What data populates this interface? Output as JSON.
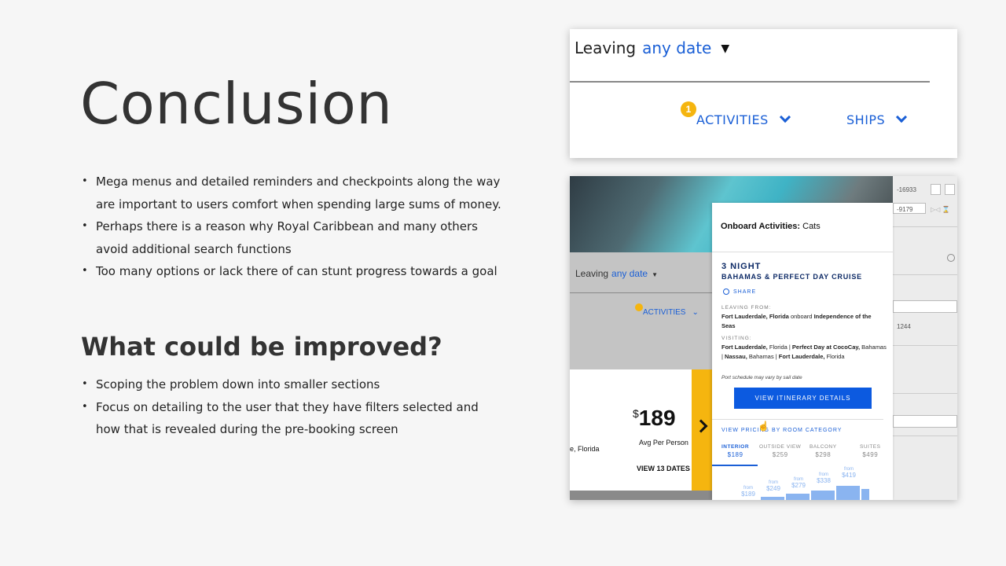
{
  "left": {
    "title": "Conclusion",
    "bullets1": [
      "Mega menus and detailed reminders and checkpoints along the way are important to users comfort  when spending large sums of money.",
      "Perhaps there is a reason why Royal Caribbean and many others avoid additional search functions",
      "Too many options or lack there of can stunt progress towards a goal"
    ],
    "subtitle": "What could be improved?",
    "bullets2": [
      "Scoping the problem down into smaller sections",
      "Focus on detailing to the user that they have filters selected and how that is revealed during the pre-booking screen"
    ]
  },
  "card1": {
    "leaving_label": "Leaving",
    "leaving_value": "any date",
    "badge": "1",
    "activities": "ACTIVITIES",
    "ships": "SHIPS"
  },
  "card2": {
    "leaving_label": "Leaving",
    "leaving_value": "any date",
    "activities": "ACTIVITIES",
    "price_symbol": "$",
    "price": "189",
    "avg": "Avg Per Person",
    "view_dates": "VIEW 13 DATES",
    "location_partial": "e, Florida",
    "side_values": [
      "-16933",
      "-9179",
      "1244"
    ],
    "popup": {
      "title_bold": "Onboard Activities:",
      "title_value": "Cats",
      "nights": "3 NIGHT",
      "cruise": "BAHAMAS & PERFECT DAY CRUISE",
      "share": "SHARE",
      "leaving_label": "LEAVING FROM:",
      "leaving_city": "Fort Lauderdale, Florida",
      "onboard_word": "onboard",
      "ship": "Independence of the Seas",
      "visiting_label": "VISITING:",
      "visit1_bold": "Fort Lauderdale,",
      "visit1_rest": "Florida",
      "visit2": "Perfect Day at CocoCay,",
      "visit3_rest": "Bahamas",
      "visit4_bold": "Nassau,",
      "visit4_rest": "Bahamas",
      "visit5_bold": "Fort Lauderdale,",
      "visit5_rest": "Florida",
      "port_note": "Port schedule may vary by sail date",
      "itinerary_button": "VIEW ITINERARY DETAILS",
      "pricing_label": "VIEW PRICING BY ROOM CATEGORY",
      "tabs": [
        {
          "label": "INTERIOR",
          "price": "$189"
        },
        {
          "label": "OUTSIDE VIEW",
          "price": "$259"
        },
        {
          "label": "BALCONY",
          "price": "$298"
        },
        {
          "label": "SUITES",
          "price": "$499"
        }
      ],
      "bars": [
        {
          "from": "from",
          "price": "$189"
        },
        {
          "from": "from",
          "price": "$249"
        },
        {
          "from": "from",
          "price": "$279"
        },
        {
          "from": "from",
          "price": "$338"
        },
        {
          "from": "from",
          "price": "$419"
        }
      ]
    }
  },
  "colors": {
    "accent": "#1a5fd6",
    "yellow": "#f5b50f",
    "button": "#0c5ae0"
  }
}
